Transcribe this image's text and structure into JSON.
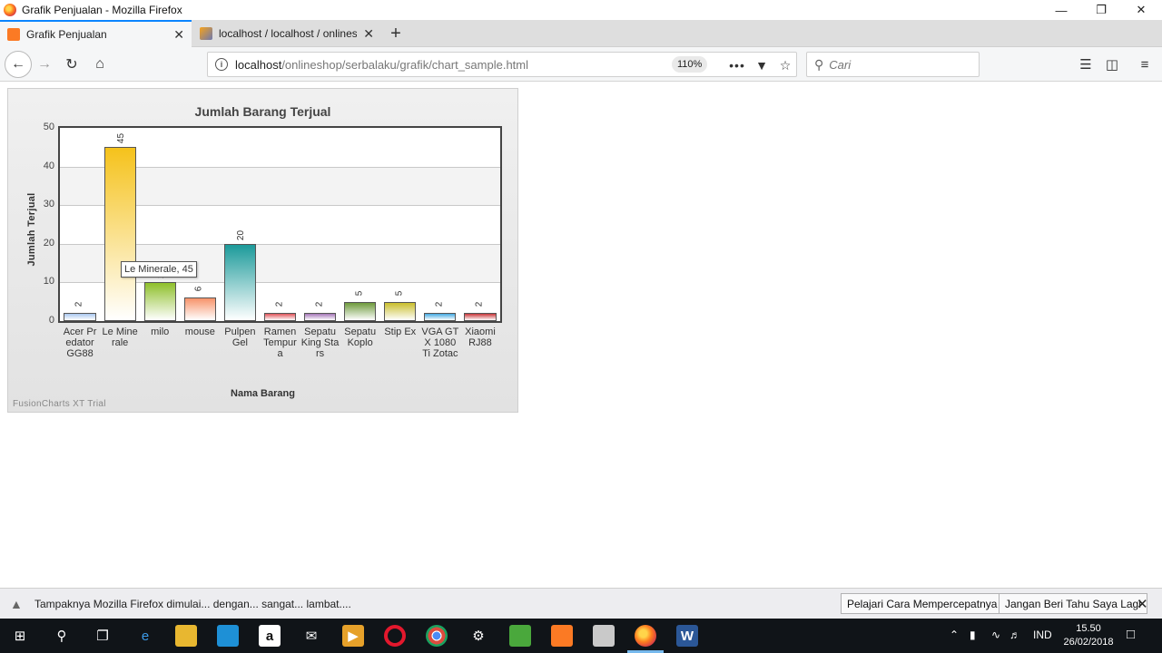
{
  "window": {
    "title": "Grafik Penjualan - Mozilla Firefox",
    "minimize_icon": "minimize-icon",
    "restore_icon": "restore-icon",
    "close_icon": "close-icon"
  },
  "tabs": [
    {
      "label": "Grafik Penjualan",
      "active": true,
      "favicon": "xampp-icon"
    },
    {
      "label": "localhost / localhost / onlinesh",
      "active": false,
      "favicon": "phpmyadmin-icon"
    }
  ],
  "navbar": {
    "url_host": "localhost",
    "url_path": "/onlineshop/serbalaku/grafik/chart_sample.html",
    "zoom": "110%",
    "search_placeholder": "Cari"
  },
  "chart_data": {
    "type": "bar",
    "title": "Jumlah Barang Terjual",
    "xlabel": "Nama Barang",
    "ylabel": "Jumlah Terjual",
    "ylim": [
      0,
      50
    ],
    "yticks": [
      "0",
      "10",
      "20",
      "30",
      "40",
      "50"
    ],
    "categories": [
      "Acer Predator GG88",
      "Le Minerale",
      "milo",
      "mouse",
      "Pulpen Gel",
      "Ramen Tempura",
      "Sepatu King Stars",
      "Sepatu Koplo",
      "Stip Ex",
      "VGA GTX 1080 Ti Zotac",
      "Xiaomi RJ88"
    ],
    "values": [
      2,
      45,
      10,
      6,
      20,
      2,
      2,
      5,
      5,
      2,
      2
    ],
    "colors": [
      "#a9c7ef",
      "#f5c21b",
      "#8ebf2a",
      "#f7936a",
      "#1c9a9a",
      "#e0545a",
      "#a577b8",
      "#6e9a3c",
      "#c9be2c",
      "#44a9e2",
      "#c8363a"
    ],
    "tooltip": "Le Minerale, 45",
    "grid": true,
    "watermark": "FusionCharts XT Trial"
  },
  "notification": {
    "text": "Tampaknya Mozilla Firefox dimulai... dengan... sangat... lambat....",
    "learn_button": "Pelajari Cara Mempercepatnya",
    "dismiss_button": "Jangan Beri Tahu Saya Lagi"
  },
  "taskbar": {
    "language": "IND",
    "time": "15.50",
    "date": "26/02/2018"
  }
}
